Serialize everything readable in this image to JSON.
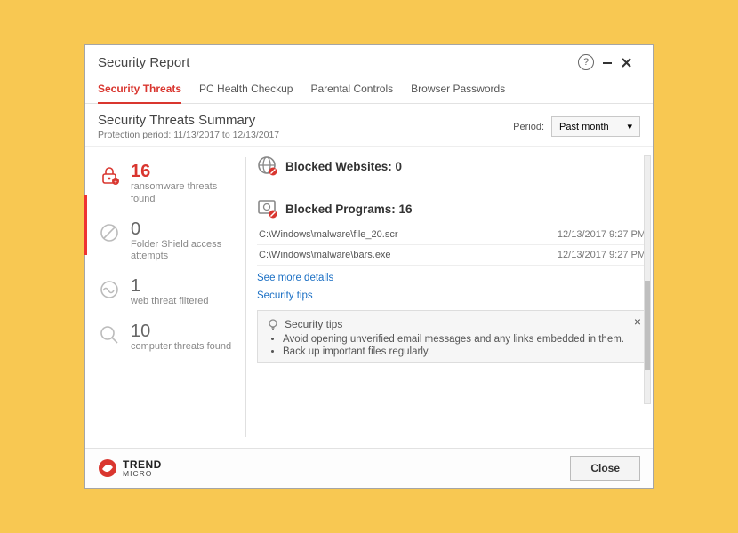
{
  "window": {
    "title": "Security Report"
  },
  "tabs": [
    "Security Threats",
    "PC Health Checkup",
    "Parental Controls",
    "Browser Passwords"
  ],
  "summary": {
    "title": "Security Threats Summary",
    "protection_line": "Protection period: 11/13/2017 to 12/13/2017",
    "period_label": "Period:",
    "period_value": "Past month"
  },
  "stats": {
    "ransomware": {
      "count": "16",
      "label": "ransomware threats found"
    },
    "folder": {
      "count": "0",
      "label": "Folder Shield access attempts"
    },
    "web": {
      "count": "1",
      "label": "web threat filtered"
    },
    "computer": {
      "count": "10",
      "label": "computer threats found"
    }
  },
  "blocked_websites": {
    "title": "Blocked Websites: 0"
  },
  "blocked_programs": {
    "title": "Blocked Programs: 16",
    "rows": [
      {
        "path": "C:\\Windows\\malware\\file_20.scr",
        "date": "12/13/2017 9:27 PM"
      },
      {
        "path": "C:\\Windows\\malware\\bars.exe",
        "date": "12/13/2017 9:27 PM"
      }
    ]
  },
  "links": {
    "details": "See more details",
    "tips": "Security tips"
  },
  "tips_box": {
    "title": "Security tips",
    "items": [
      "Avoid opening unverified email messages and any links embedded in them.",
      "Back up important files regularly."
    ]
  },
  "brand": {
    "line1": "TREND",
    "line2": "MICRO"
  },
  "footer": {
    "close": "Close"
  }
}
